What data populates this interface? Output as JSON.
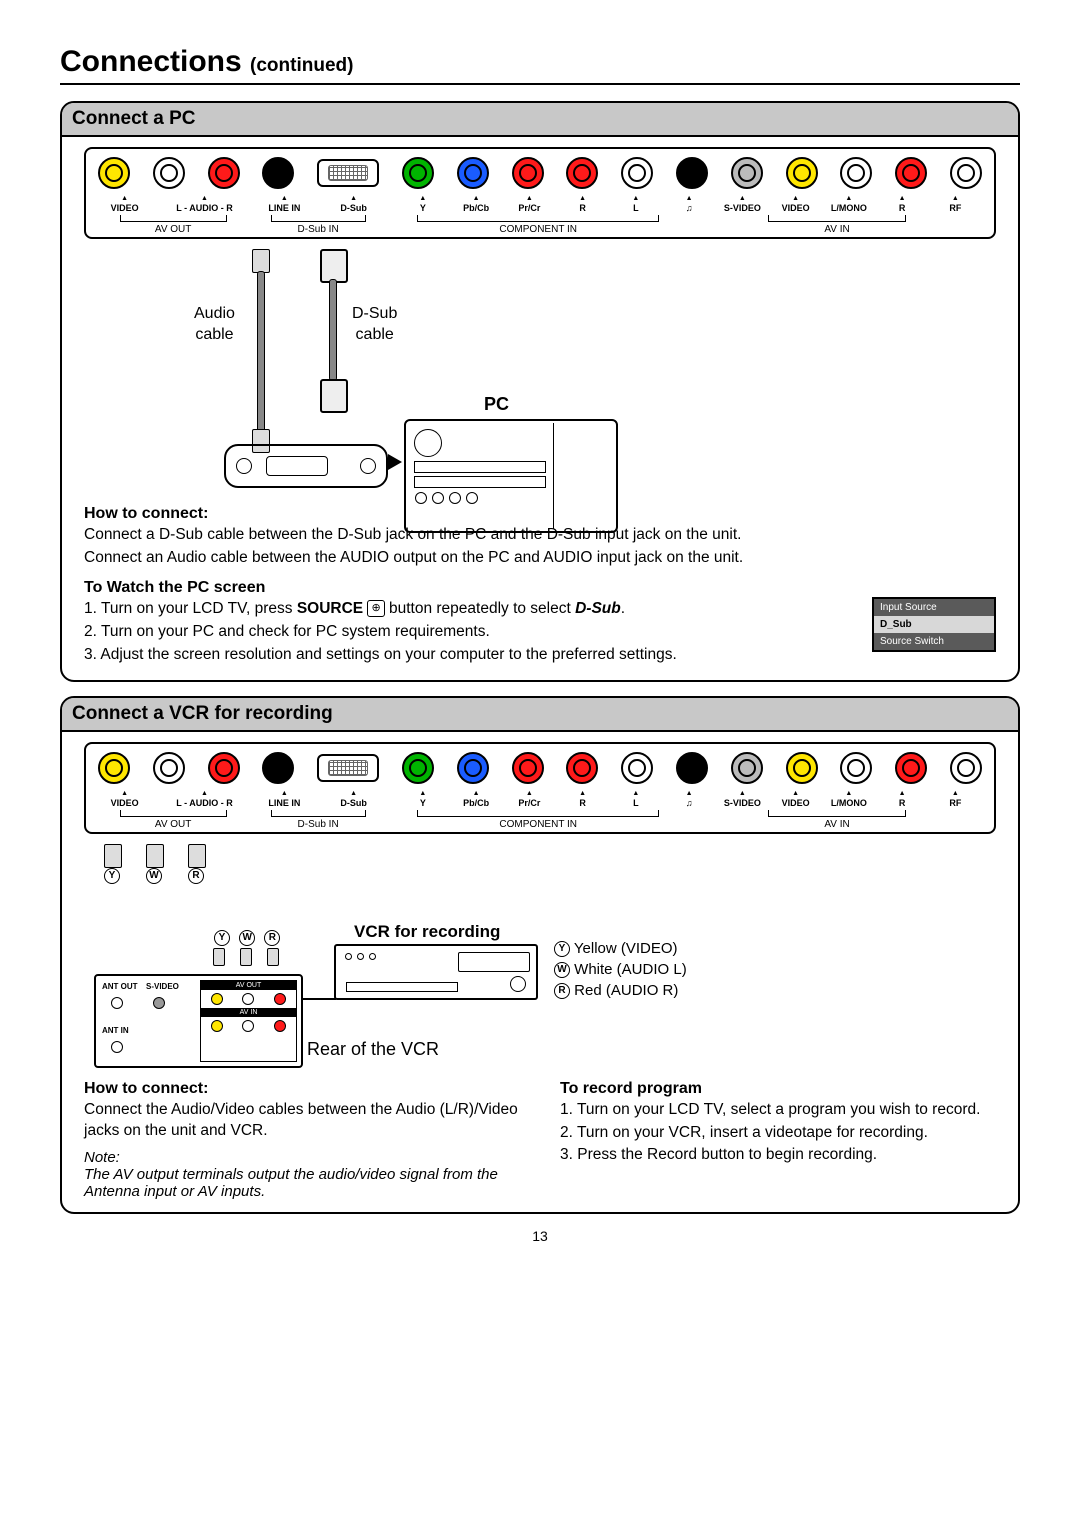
{
  "title_main": "Connections",
  "title_cont": "(continued)",
  "section_pc": {
    "header": "Connect a PC",
    "cable_audio": "Audio\ncable",
    "cable_dsub": "D-Sub\ncable",
    "pc_label": "PC",
    "how_to_connect_h": "How to connect:",
    "how_line1": "Connect a D-Sub cable between the D-Sub jack on the PC and the D-Sub input jack on the unit.",
    "how_line2": "Connect an Audio cable between the AUDIO output on the PC and AUDIO input jack on the unit.",
    "watch_h": "To Watch the PC screen",
    "watch_1a": "1. Turn on your LCD TV, press ",
    "watch_1_source": "SOURCE",
    "watch_1b": " button repeatedly to select ",
    "watch_1_dsub": "D-Sub",
    "watch_1c": ".",
    "watch_2": "2. Turn on your PC and check for PC system requirements.",
    "watch_3": "3. Adjust the screen resolution and settings on your computer to the preferred settings.",
    "source_box": {
      "title": "Input Source",
      "selected": "D_Sub",
      "footer": "Source Switch"
    }
  },
  "section_vcr": {
    "header": "Connect a VCR for recording",
    "vcr_label": "VCR for recording",
    "rear_label": "Rear of the VCR",
    "legend_y": "Yellow (VIDEO)",
    "legend_w": "White (AUDIO L)",
    "legend_r": "Red (AUDIO R)",
    "how_h": "How to connect:",
    "how_text": "Connect the Audio/Video cables between the Audio (L/R)/Video  jacks on the unit and VCR.",
    "record_h": "To record program",
    "record_1": "1. Turn on your LCD TV, select a program you wish to record.",
    "record_2": "2. Turn on your VCR, insert a videotape for recording.",
    "record_3": "3. Press the Record button to begin recording.",
    "note_label": "Note:",
    "note_text": "The AV output terminals output the audio/video signal from the Antenna input or AV inputs."
  },
  "panel_labels": {
    "video": "VIDEO",
    "l": "L",
    "audio": "AUDIO",
    "r": "R",
    "linein": "LINE IN",
    "dsub": "D-Sub",
    "y": "Y",
    "pbcb": "Pb/Cb",
    "prcr": "Pr/Cr",
    "r2": "R",
    "l2": "L",
    "hp": "♫",
    "svideo": "S-VIDEO",
    "video2": "VIDEO",
    "lmono": "L/MONO",
    "r3": "R",
    "rf": "RF",
    "avout": "AV OUT",
    "dsubin": "D-Sub IN",
    "compin": "COMPONENT IN",
    "avin": "AV IN",
    "laudior": "L - AUDIO - R"
  },
  "vcr_rear": {
    "antout": "ANT OUT",
    "svideo": "S-VIDEO",
    "antin": "ANT IN",
    "avout": "AV OUT",
    "avin": "AV IN"
  },
  "page_number": "13"
}
